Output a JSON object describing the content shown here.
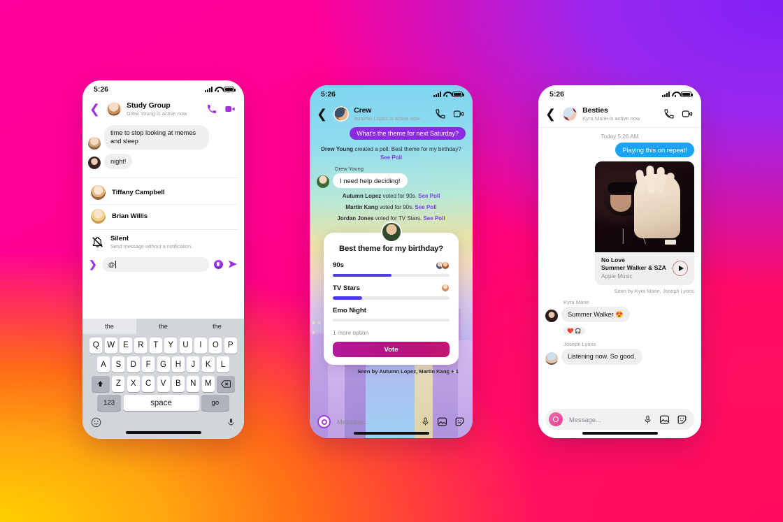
{
  "background": {
    "colors": [
      "#FF009C",
      "#8020F5",
      "#FF0A5C",
      "#FFD000",
      "#FF6A18"
    ]
  },
  "status_bar": {
    "time": "5:26"
  },
  "phone1": {
    "header": {
      "title": "Study Group",
      "subtitle": "Drew Young is active now",
      "back_icon": "chevron-left-icon",
      "call_icon": "phone-call-icon",
      "video_icon": "video-camera-icon"
    },
    "messages": [
      {
        "text": "time to stop looking at memes and sleep"
      },
      {
        "text": "night!"
      }
    ],
    "mention_list": [
      {
        "name": "Tiffany Campbell"
      },
      {
        "name": "Brian Willis"
      }
    ],
    "silent": {
      "title": "Silent",
      "subtitle": "Send message without a notification.",
      "icon": "bell-slash-icon"
    },
    "composer": {
      "input_value": "@",
      "expand_icon": "chevron-right-icon",
      "voice_icon": "voice-record-icon",
      "send_icon": "send-arrow-icon"
    },
    "keyboard": {
      "predictions": [
        "the",
        "the",
        "the"
      ],
      "row1": [
        "Q",
        "W",
        "E",
        "R",
        "T",
        "Y",
        "U",
        "I",
        "O",
        "P"
      ],
      "row2": [
        "A",
        "S",
        "D",
        "F",
        "G",
        "H",
        "J",
        "K",
        "L"
      ],
      "row3": [
        "Z",
        "X",
        "C",
        "V",
        "B",
        "N",
        "M"
      ],
      "shift_icon": "shift-arrow-icon",
      "backspace_icon": "backspace-icon",
      "numbers_key": "123",
      "space_key": "space",
      "go_key": "go",
      "emoji_icon": "emoji-smiley-icon",
      "dictation_icon": "microphone-icon"
    }
  },
  "phone2": {
    "header": {
      "title": "Crew",
      "subtitle": "Autumn Lopez is active now",
      "back_icon": "chevron-left-icon",
      "call_icon": "phone-call-icon",
      "video_icon": "video-camera-icon"
    },
    "top_bubble": "What's the theme for next Saturday?",
    "poll_created": {
      "actor": "Drew Young",
      "text": " created a poll: Best theme for my birthday? ",
      "link": "See Poll"
    },
    "reply": {
      "sender": "Drew Young",
      "text": "I need help deciding!"
    },
    "vote_events": [
      {
        "actor": "Autumn Lopez",
        "text": " voted for 90s. ",
        "link": "See Poll"
      },
      {
        "actor": "Martin Kang",
        "text": " voted for 90s. ",
        "link": "See Poll"
      },
      {
        "actor": "Jordan Jones",
        "text": " voted for TV Stars. ",
        "link": "See Poll"
      }
    ],
    "poll_card": {
      "question": "Best theme for my birthday?",
      "options": [
        {
          "label": "90s",
          "percent": 50,
          "voters": 2
        },
        {
          "label": "TV Stars",
          "percent": 25,
          "voters": 1
        },
        {
          "label": "Emo Night",
          "percent": 0,
          "voters": 0
        }
      ],
      "more_option": "1 more option",
      "vote_button": "Vote"
    },
    "seen_by": "Seen by Autumn Lopez, Martin Kang + 1",
    "composer": {
      "placeholder": "Message...",
      "camera_icon": "camera-icon",
      "mic_icon": "microphone-icon",
      "gallery_icon": "photo-gallery-icon",
      "sticker_icon": "sticker-icon"
    }
  },
  "phone3": {
    "header": {
      "title": "Besties",
      "subtitle": "Kyra Marie is active now",
      "back_icon": "chevron-left-icon",
      "call_icon": "phone-call-icon",
      "video_icon": "video-camera-icon"
    },
    "day_stamp": "Today 5:26 AM",
    "outgoing_message": "Playing this on repeat!",
    "music_card": {
      "track": "No Love",
      "artist": "Summer Walker & SZA",
      "source": "Apple Music",
      "play_icon": "play-icon",
      "forward_icon": "forward-arrow-icon"
    },
    "seen_by": "Seen by Kyra Marie, Joseph Lyons",
    "replies": [
      {
        "sender": "Kyra Marie",
        "text": "Summer Walker 😍",
        "reactions": "❤️ 🎧"
      },
      {
        "sender": "Joseph Lyons",
        "text": "Listening now. So good."
      }
    ],
    "composer": {
      "placeholder": "Message...",
      "camera_icon": "camera-icon",
      "mic_icon": "microphone-icon",
      "gallery_icon": "photo-gallery-icon",
      "sticker_icon": "sticker-icon"
    }
  }
}
